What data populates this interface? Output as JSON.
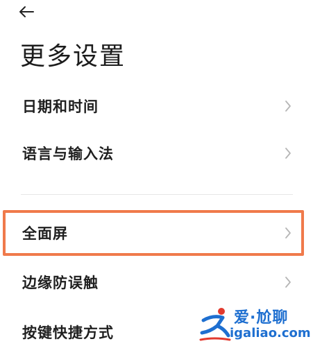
{
  "header": {
    "back_icon": "arrow-left-icon",
    "title": "更多设置"
  },
  "settings": {
    "items": [
      {
        "label": "日期和时间",
        "icon": "chevron-right-icon"
      },
      {
        "label": "语言与输入法",
        "icon": "chevron-right-icon"
      },
      {
        "label": "全面屏",
        "icon": "chevron-right-icon",
        "highlighted": true
      },
      {
        "label": "边缘防误触",
        "icon": "chevron-right-icon"
      },
      {
        "label": "按键快捷方式",
        "icon": "chevron-right-icon"
      }
    ]
  },
  "highlight": {
    "color": "#f07a4b"
  },
  "watermark": {
    "line1": "爱·尬聊",
    "line2": "igaliao.com",
    "color": "#1e6fd0",
    "accent_color": "#e23a2e"
  },
  "colors": {
    "background": "#ffffff",
    "text": "#1f1f1f",
    "chevron": "#b5b5b5",
    "divider": "#e6e6e6"
  }
}
